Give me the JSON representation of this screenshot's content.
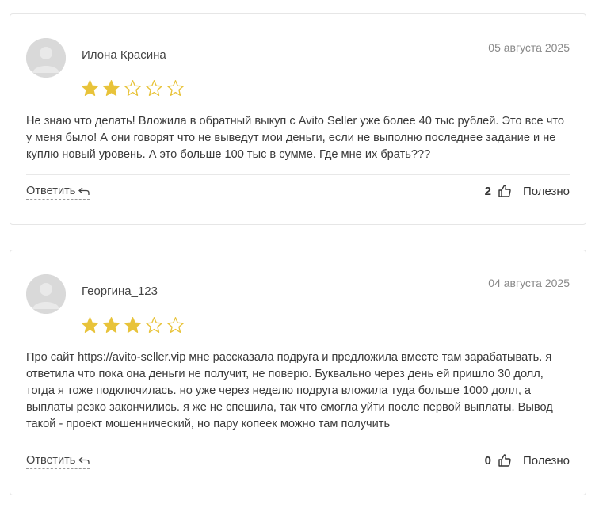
{
  "reviews": [
    {
      "author": "Илона Красина",
      "date": "05 августа 2025",
      "rating": 2,
      "max_rating": 5,
      "text": "Не знаю что делать! Вложила в обратный выкуп с Avito Seller уже более 40 тыс рублей. Это все что у меня было! А они говорят что не выведут мои деньги, если не выполню последнее задание и не куплю новый уровень. А это больше 100 тыс в сумме. Где мне их брать???",
      "reply_label": "Ответить",
      "helpful_count": "2",
      "helpful_label": "Полезно"
    },
    {
      "author": "Георгина_123",
      "date": "04 августа 2025",
      "rating": 3,
      "max_rating": 5,
      "text": "Про сайт https://avito-seller.vip мне рассказала подруга и предложила вместе там зарабатывать. я ответила что пока она деньги не получит, не поверю. Буквально через день ей пришло 30 долл, тогда я тоже подключилась. но уже через неделю подруга вложила туда больше 1000 долл, а выплаты резко закончились. я же не спешила, так что смогла уйти после первой выплаты. Вывод такой - проект мошеннический, но пару копеек можно там получить",
      "reply_label": "Ответить",
      "helpful_count": "0",
      "helpful_label": "Полезно"
    }
  ],
  "colors": {
    "star_filled": "#E8C33A",
    "star_empty_stroke": "#E8C33A",
    "avatar_bg": "#D9D9D9",
    "text": "#3A3A3A",
    "muted": "#888888"
  },
  "icons": {
    "avatar": "user-silhouette-icon",
    "star": "star-icon",
    "reply": "reply-arrow-icon",
    "like": "thumbs-up-icon"
  }
}
